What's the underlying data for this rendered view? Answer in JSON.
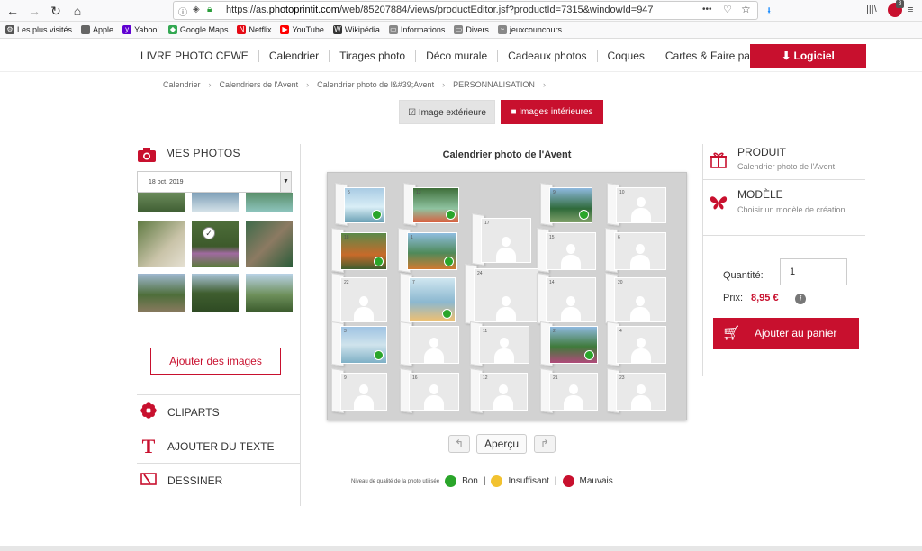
{
  "browser": {
    "back": "←",
    "forward": "→",
    "reload": "↻",
    "home": "⌂",
    "url_prefix": "https://as.",
    "url_domain": "photoprintit.com",
    "url_rest": "/web/85207884/views/productEditor.jsf?productId=7315&windowId=947",
    "menu_dots": "•••",
    "notif_count": "3"
  },
  "bookmarks": [
    {
      "label": "Les plus visités",
      "icon": "gear-icon"
    },
    {
      "label": "Apple",
      "icon": "apple-icon"
    },
    {
      "label": "Yahoo!",
      "icon": "yahoo-icon"
    },
    {
      "label": "Google Maps",
      "icon": "maps-icon"
    },
    {
      "label": "Netflix",
      "icon": "netflix-icon"
    },
    {
      "label": "YouTube",
      "icon": "youtube-icon"
    },
    {
      "label": "Wikipédia",
      "icon": "wikipedia-icon"
    },
    {
      "label": "Informations",
      "icon": "folder-icon"
    },
    {
      "label": "Divers",
      "icon": "folder-icon"
    },
    {
      "label": "jeuxcouncours",
      "icon": "link-icon"
    }
  ],
  "nav": {
    "items": [
      "LIVRE PHOTO CEWE",
      "Calendrier",
      "Tirages photo",
      "Déco murale",
      "Cadeaux photos",
      "Coques",
      "Cartes & Faire part"
    ],
    "logiciel": "Logiciel"
  },
  "breadcrumb": [
    "Calendrier",
    "Calendriers de l'Avent",
    "Calendrier photo de l&#39;Avent",
    "PERSONNALISATION"
  ],
  "tabs": {
    "exterior": "Image extérieure",
    "interior": "Images intérieures"
  },
  "left": {
    "mes_photos": "MES PHOTOS",
    "date_value": "18 oct. 2019",
    "add_images": "Ajouter des images",
    "cliparts": "CLIPARTS",
    "add_text": "AJOUTER DU TEXTE",
    "draw": "DESSINER"
  },
  "center": {
    "title": "Calendrier photo de l'Avent",
    "preview": "Aperçu",
    "quality_label": "Niveau de qualité de la photo utilisée",
    "good": "Bon",
    "insufficient": "Insuffisant",
    "bad": "Mauvais",
    "sep": "|"
  },
  "doors": [
    {
      "n": "5",
      "photo": true
    },
    {
      "n": "13",
      "photo": true
    },
    {
      "n": "9",
      "photo": true
    },
    {
      "n": "10",
      "photo": false
    },
    {
      "n": "18",
      "photo": true
    },
    {
      "n": "1",
      "photo": true
    },
    {
      "n": "17",
      "photo": false
    },
    {
      "n": "15",
      "photo": false
    },
    {
      "n": "6",
      "photo": false
    },
    {
      "n": "22",
      "photo": false
    },
    {
      "n": "7",
      "photo": true
    },
    {
      "n": "24",
      "photo": false
    },
    {
      "n": "14",
      "photo": false
    },
    {
      "n": "20",
      "photo": false
    },
    {
      "n": "3",
      "photo": true
    },
    {
      "n": "",
      "photo": false
    },
    {
      "n": "11",
      "photo": false
    },
    {
      "n": "2",
      "photo": true
    },
    {
      "n": "4",
      "photo": false
    },
    {
      "n": "9",
      "photo": false
    },
    {
      "n": "16",
      "photo": false
    },
    {
      "n": "12",
      "photo": false
    },
    {
      "n": "21",
      "photo": false
    },
    {
      "n": "23",
      "photo": false
    }
  ],
  "right": {
    "produit": "PRODUIT",
    "produit_sub": "Calendrier photo de l'Avent",
    "modele": "MODÈLE",
    "modele_sub": "Choisir un modèle de création",
    "quantite_label": "Quantité:",
    "quantite_value": "1",
    "prix_label": "Prix:",
    "prix_value": "8,95 €",
    "info": "i",
    "cart": "Ajouter au panier"
  },
  "colors": {
    "accent": "#c8102e",
    "good": "#2aa52a",
    "insufficient": "#f2c230",
    "bad": "#c8102e"
  }
}
